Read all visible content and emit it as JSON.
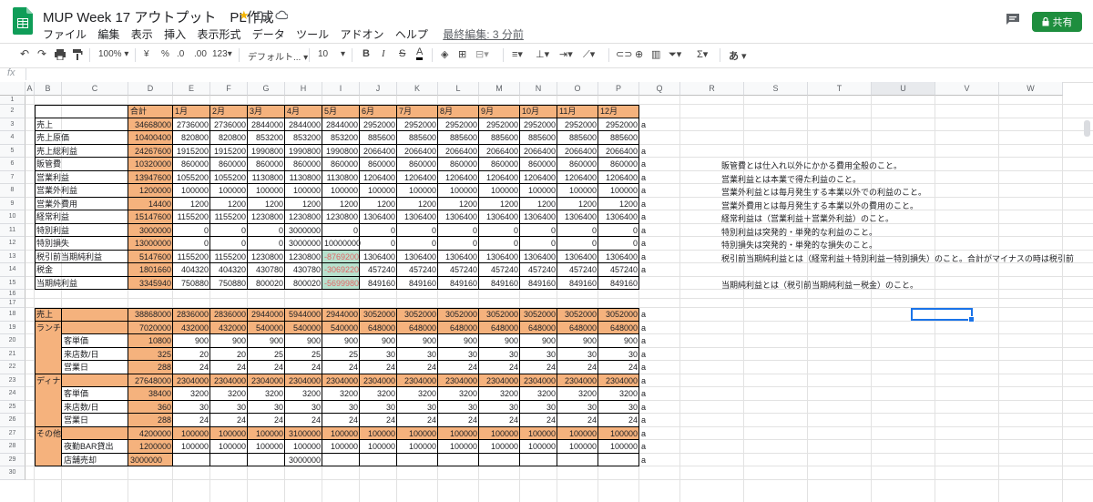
{
  "doc_title": "MUP Week 17 アウトプット　PL作成",
  "menus": [
    "ファイル",
    "編集",
    "表示",
    "挿入",
    "表示形式",
    "データ",
    "ツール",
    "アドオン",
    "ヘルプ"
  ],
  "last_edit": "最終編集: 3 分前",
  "share_label": "共有",
  "toolbar": {
    "zoom": "100%",
    "currency": "¥",
    "percent": "%",
    "dec1": ".0",
    "dec2": ".00",
    "fmt": "123",
    "font": "デフォルト...",
    "size": "10",
    "bold": "B",
    "italic": "I",
    "strike": "S",
    "textcolor": "A",
    "input_tool": "あ"
  },
  "fx": "fx",
  "col_headers": [
    "A",
    "B",
    "C",
    "D",
    "E",
    "F",
    "G",
    "H",
    "I",
    "J",
    "K",
    "L",
    "M",
    "N",
    "O",
    "P",
    "Q",
    "R",
    "S",
    "T",
    "U",
    "V",
    "W"
  ],
  "row_numbers": [
    "1",
    "2",
    "3",
    "4",
    "5",
    "6",
    "7",
    "8",
    "9",
    "10",
    "11",
    "12",
    "13",
    "14",
    "15",
    "16",
    "17",
    "18",
    "19",
    "20",
    "21",
    "22",
    "23",
    "24",
    "25",
    "26",
    "27",
    "28",
    "29",
    "30"
  ],
  "pl_header": [
    "合計",
    "1月",
    "2月",
    "3月",
    "4月",
    "5月",
    "6月",
    "7月",
    "8月",
    "9月",
    "10月",
    "11月",
    "12月"
  ],
  "pl_rows": [
    {
      "label": "売上",
      "vals": [
        "34668000",
        "2736000",
        "2736000",
        "2844000",
        "2844000",
        "2844000",
        "2952000",
        "2952000",
        "2952000",
        "2952000",
        "2952000",
        "2952000",
        "2952000"
      ],
      "a": "a"
    },
    {
      "label": "売上原価",
      "vals": [
        "10400400",
        "820800",
        "820800",
        "853200",
        "853200",
        "853200",
        "885600",
        "885600",
        "885600",
        "885600",
        "885600",
        "885600",
        "885600"
      ],
      "a": ""
    },
    {
      "label": "売上総利益",
      "vals": [
        "24267600",
        "1915200",
        "1915200",
        "1990800",
        "1990800",
        "1990800",
        "2066400",
        "2066400",
        "2066400",
        "2066400",
        "2066400",
        "2066400",
        "2066400"
      ],
      "a": "a"
    },
    {
      "label": "販管費",
      "vals": [
        "10320000",
        "860000",
        "860000",
        "860000",
        "860000",
        "860000",
        "860000",
        "860000",
        "860000",
        "860000",
        "860000",
        "860000",
        "860000"
      ],
      "a": "a"
    },
    {
      "label": "営業利益",
      "vals": [
        "13947600",
        "1055200",
        "1055200",
        "1130800",
        "1130800",
        "1130800",
        "1206400",
        "1206400",
        "1206400",
        "1206400",
        "1206400",
        "1206400",
        "1206400"
      ],
      "a": "a"
    },
    {
      "label": "営業外利益",
      "vals": [
        "1200000",
        "100000",
        "100000",
        "100000",
        "100000",
        "100000",
        "100000",
        "100000",
        "100000",
        "100000",
        "100000",
        "100000",
        "100000"
      ],
      "a": "a"
    },
    {
      "label": "営業外費用",
      "vals": [
        "14400",
        "1200",
        "1200",
        "1200",
        "1200",
        "1200",
        "1200",
        "1200",
        "1200",
        "1200",
        "1200",
        "1200",
        "1200"
      ],
      "a": "a"
    },
    {
      "label": "経常利益",
      "vals": [
        "15147600",
        "1155200",
        "1155200",
        "1230800",
        "1230800",
        "1230800",
        "1306400",
        "1306400",
        "1306400",
        "1306400",
        "1306400",
        "1306400",
        "1306400"
      ],
      "a": "a"
    },
    {
      "label": "特別利益",
      "vals": [
        "3000000",
        "0",
        "0",
        "0",
        "3000000",
        "0",
        "0",
        "0",
        "0",
        "0",
        "0",
        "0",
        "0"
      ],
      "a": "a"
    },
    {
      "label": "特別損失",
      "vals": [
        "13000000",
        "0",
        "0",
        "0",
        "3000000",
        "10000000",
        "0",
        "0",
        "0",
        "0",
        "0",
        "0",
        "0"
      ],
      "a": "a"
    },
    {
      "label": "税引前当期純利益",
      "vals": [
        "5147600",
        "1155200",
        "1155200",
        "1230800",
        "1230800",
        "-8769200",
        "1306400",
        "1306400",
        "1306400",
        "1306400",
        "1306400",
        "1306400",
        "1306400"
      ],
      "a": "a"
    },
    {
      "label": "税金",
      "vals": [
        "1801660",
        "404320",
        "404320",
        "430780",
        "430780",
        "-3069220",
        "457240",
        "457240",
        "457240",
        "457240",
        "457240",
        "457240",
        "457240"
      ],
      "a": "a"
    },
    {
      "label": "当期純利益",
      "vals": [
        "3345940",
        "750880",
        "750880",
        "800020",
        "800020",
        "-5699980",
        "849160",
        "849160",
        "849160",
        "849160",
        "849160",
        "849160",
        "849160"
      ],
      "a": ""
    }
  ],
  "notes": [
    {
      "row": 6,
      "text": "販管費とは仕入れ以外にかかる費用全般のこと。"
    },
    {
      "row": 7,
      "text": "営業利益とは本業で得た利益のこと。"
    },
    {
      "row": 8,
      "text": "営業外利益とは毎月発生する本業以外での利益のこと。"
    },
    {
      "row": 9,
      "text": "営業外費用とは毎月発生する本業以外の費用のこと。"
    },
    {
      "row": 10,
      "text": "経常利益は（営業利益＋営業外利益）のこと。"
    },
    {
      "row": 11,
      "text": "特別利益は突発的・単発的な利益のこと。"
    },
    {
      "row": 12,
      "text": "特別損失は突発的・単発的な損失のこと。"
    },
    {
      "row": 13,
      "text": "税引前当期純利益とは（経常利益＋特別利益ー特別損失）のこと。合計がマイナスの時は税引前"
    },
    {
      "row": 15,
      "text": "当期純利益とは（税引前当期純利益ー税金）のこと。"
    }
  ],
  "sales_rows": [
    {
      "row": 18,
      "b": "売上",
      "c": "",
      "vals": [
        "38868000",
        "2836000",
        "2836000",
        "2944000",
        "5944000",
        "2944000",
        "3052000",
        "3052000",
        "3052000",
        "3052000",
        "3052000",
        "3052000",
        "3052000"
      ],
      "a": "a",
      "kind": "main"
    },
    {
      "row": 19,
      "b": "ランチ",
      "c": "",
      "vals": [
        "7020000",
        "432000",
        "432000",
        "540000",
        "540000",
        "540000",
        "648000",
        "648000",
        "648000",
        "648000",
        "648000",
        "648000",
        "648000"
      ],
      "a": "a",
      "kind": "main"
    },
    {
      "row": 20,
      "b": "",
      "c": "客単価",
      "vals": [
        "10800",
        "900",
        "900",
        "900",
        "900",
        "900",
        "900",
        "900",
        "900",
        "900",
        "900",
        "900",
        "900"
      ],
      "a": "a",
      "kind": "sub"
    },
    {
      "row": 21,
      "b": "",
      "c": "来店数/日",
      "vals": [
        "325",
        "20",
        "20",
        "25",
        "25",
        "25",
        "30",
        "30",
        "30",
        "30",
        "30",
        "30",
        "30"
      ],
      "a": "a",
      "kind": "sub"
    },
    {
      "row": 22,
      "b": "",
      "c": "営業日",
      "vals": [
        "288",
        "24",
        "24",
        "24",
        "24",
        "24",
        "24",
        "24",
        "24",
        "24",
        "24",
        "24",
        "24"
      ],
      "a": "a",
      "kind": "sub"
    },
    {
      "row": 23,
      "b": "ディナー",
      "c": "",
      "vals": [
        "27648000",
        "2304000",
        "2304000",
        "2304000",
        "2304000",
        "2304000",
        "2304000",
        "2304000",
        "2304000",
        "2304000",
        "2304000",
        "2304000",
        "2304000"
      ],
      "a": "a",
      "kind": "main"
    },
    {
      "row": 24,
      "b": "",
      "c": "客単価",
      "vals": [
        "38400",
        "3200",
        "3200",
        "3200",
        "3200",
        "3200",
        "3200",
        "3200",
        "3200",
        "3200",
        "3200",
        "3200",
        "3200"
      ],
      "a": "a",
      "kind": "sub"
    },
    {
      "row": 25,
      "b": "",
      "c": "来店数/日",
      "vals": [
        "360",
        "30",
        "30",
        "30",
        "30",
        "30",
        "30",
        "30",
        "30",
        "30",
        "30",
        "30",
        "30"
      ],
      "a": "a",
      "kind": "sub"
    },
    {
      "row": 26,
      "b": "",
      "c": "営業日",
      "vals": [
        "288",
        "24",
        "24",
        "24",
        "24",
        "24",
        "24",
        "24",
        "24",
        "24",
        "24",
        "24",
        "24"
      ],
      "a": "a",
      "kind": "sub"
    },
    {
      "row": 27,
      "b": "その他",
      "c": "",
      "vals": [
        "4200000",
        "100000",
        "100000",
        "100000",
        "3100000",
        "100000",
        "100000",
        "100000",
        "100000",
        "100000",
        "100000",
        "100000",
        "100000"
      ],
      "a": "a",
      "kind": "main"
    },
    {
      "row": 28,
      "b": "",
      "c": "夜勤BAR貸出",
      "vals": [
        "1200000",
        "100000",
        "100000",
        "100000",
        "100000",
        "100000",
        "100000",
        "100000",
        "100000",
        "100000",
        "100000",
        "100000",
        "100000"
      ],
      "a": "a",
      "kind": "sub"
    },
    {
      "row": 29,
      "b": "",
      "c": "店舗売却",
      "vals": [
        "3000000",
        "",
        "",
        "",
        "3000000",
        "",
        "",
        "",
        "",
        "",
        "",
        "",
        ""
      ],
      "a": "a",
      "kind": "sub"
    }
  ],
  "colors": {
    "orange": "#f5b27d",
    "green_neg": "#b7e1cd",
    "neg_text": "#e06666",
    "share": "#1e8e3e",
    "select": "#1a73e8"
  }
}
